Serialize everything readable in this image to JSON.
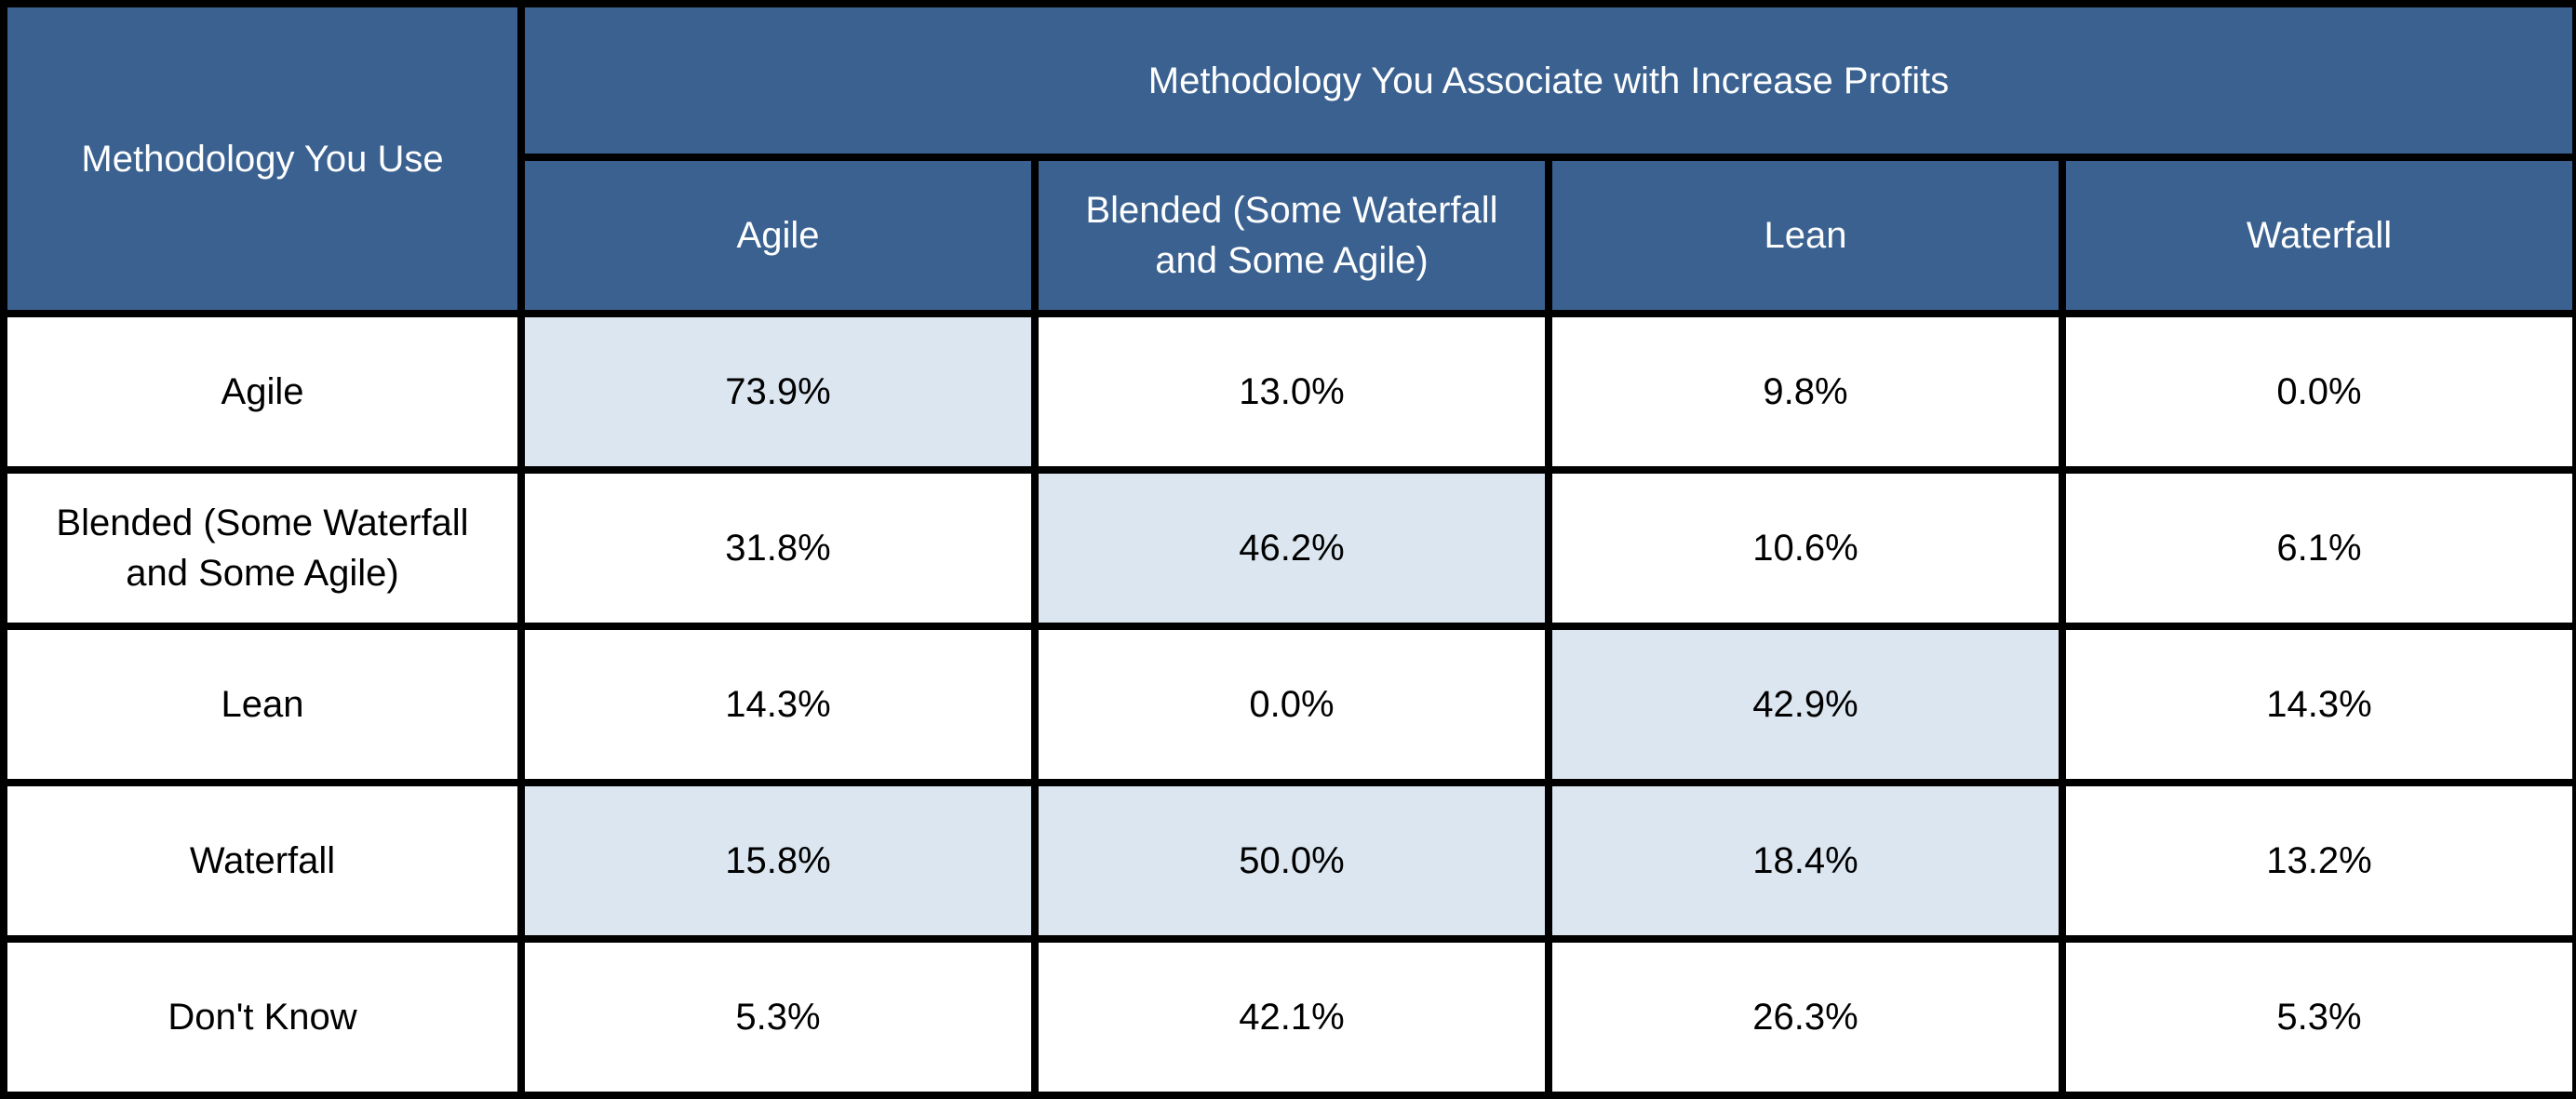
{
  "table": {
    "row_header_title": "Methodology You Use",
    "column_group_title": "Methodology You Associate with Increase Profits",
    "columns": [
      "Agile",
      "Blended (Some Waterfall and Some Agile)",
      "Lean",
      "Waterfall"
    ],
    "rows": [
      {
        "label": "Agile",
        "values": [
          "73.9%",
          "13.0%",
          "9.8%",
          "0.0%"
        ],
        "highlighted": [
          true,
          false,
          false,
          false
        ]
      },
      {
        "label": "Blended (Some Waterfall and Some Agile)",
        "values": [
          "31.8%",
          "46.2%",
          "10.6%",
          "6.1%"
        ],
        "highlighted": [
          false,
          true,
          false,
          false
        ]
      },
      {
        "label": "Lean",
        "values": [
          "14.3%",
          "0.0%",
          "42.9%",
          "14.3%"
        ],
        "highlighted": [
          false,
          false,
          true,
          false
        ]
      },
      {
        "label": "Waterfall",
        "values": [
          "15.8%",
          "50.0%",
          "18.4%",
          "13.2%"
        ],
        "highlighted": [
          true,
          true,
          true,
          false
        ]
      },
      {
        "label": "Don't Know",
        "values": [
          "5.3%",
          "42.1%",
          "26.3%",
          "5.3%"
        ],
        "highlighted": [
          false,
          false,
          false,
          false
        ]
      }
    ]
  },
  "colors": {
    "header_bg": "#3a6190",
    "header_text": "#ffffff",
    "highlight_bg": "#dce6f0",
    "border": "#000000"
  }
}
